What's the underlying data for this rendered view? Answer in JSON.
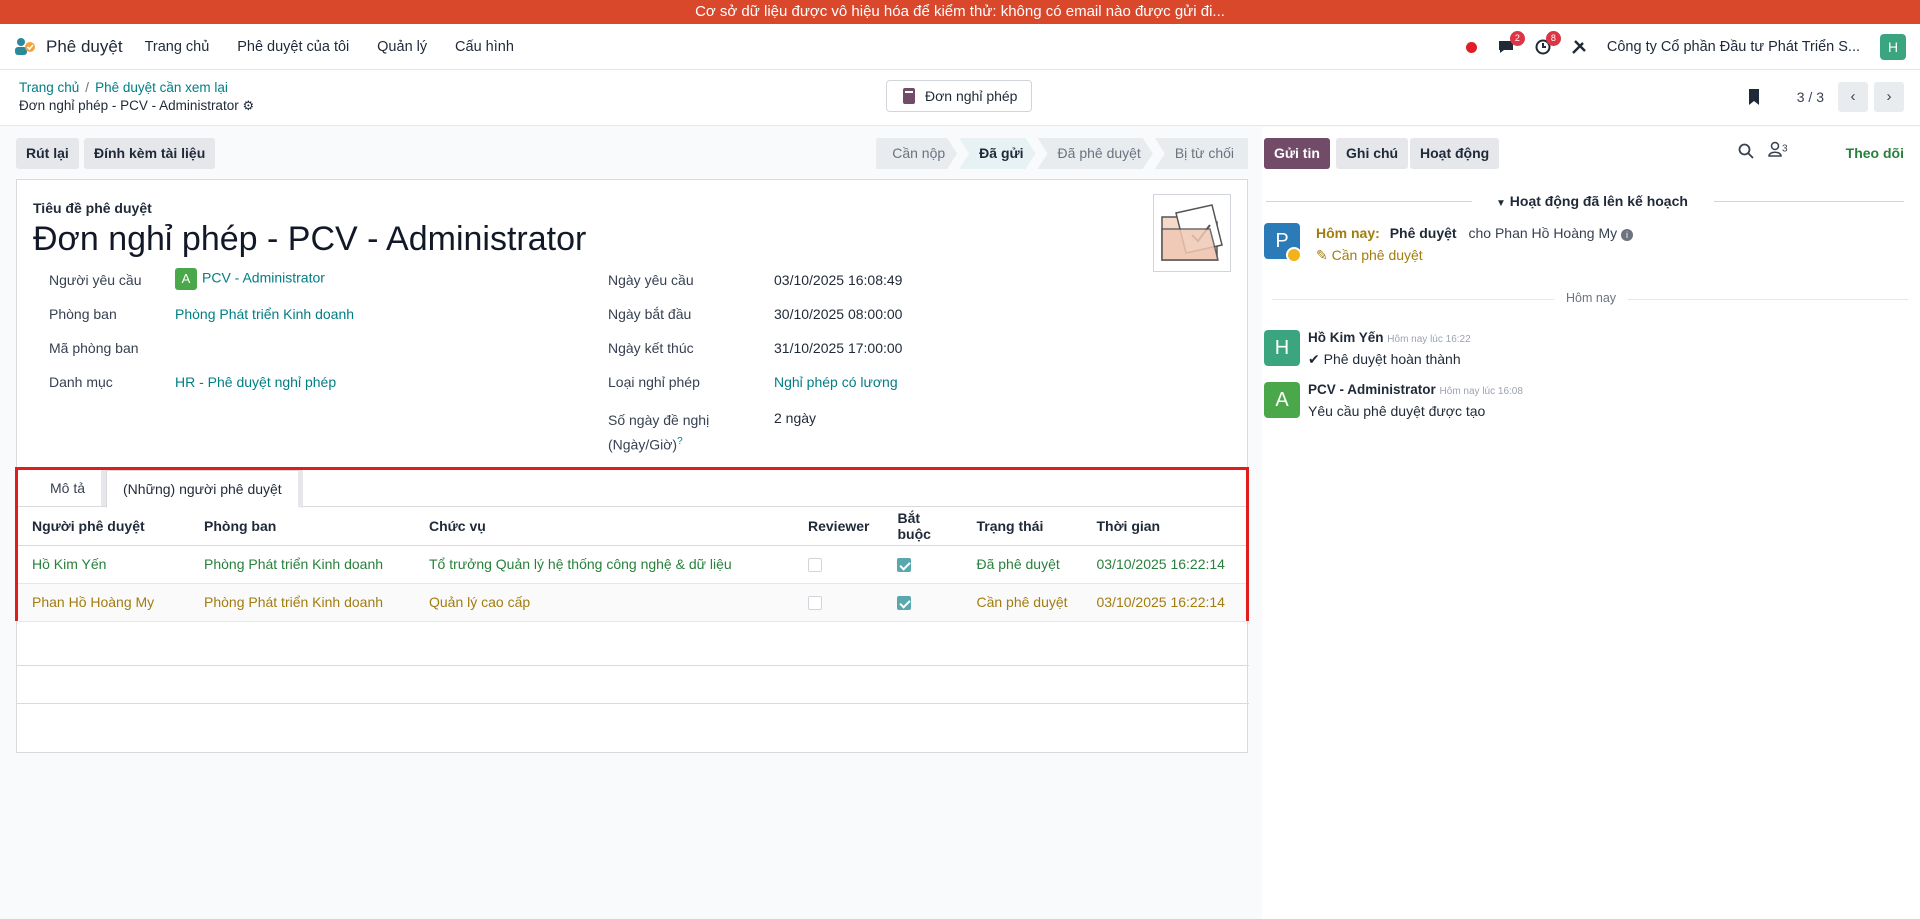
{
  "banner": {
    "text": "Cơ sở dữ liệu được vô hiệu hóa để kiểm thử: không có email nào được gửi đi..."
  },
  "navbar": {
    "app_name": "Phê duyệt",
    "menu": [
      "Trang chủ",
      "Phê duyệt của tôi",
      "Quản lý",
      "Cấu hình"
    ],
    "messages_count": "2",
    "activities_count": "8",
    "company": "Công ty Cổ phần Đầu tư Phát Triển S...",
    "user_initial": "H"
  },
  "breadcrumb": {
    "home": "Trang chủ",
    "parent": "Phê duyệt cần xem lại",
    "current": "Đơn nghỉ phép - PCV - Administrator"
  },
  "center_button": "Đơn nghỉ phép",
  "pager": {
    "text": "3 / 3"
  },
  "actions": {
    "withdraw": "Rút lại",
    "attach": "Đính kèm tài liệu"
  },
  "stages": [
    "Cần nộp",
    "Đã gửi",
    "Đã phê duyệt",
    "Bị từ chối"
  ],
  "active_stage": "Đã gửi",
  "form": {
    "title_label": "Tiêu đề phê duyệt",
    "title": "Đơn nghỉ phép - PCV - Administrator",
    "requester_label": "Người yêu cầu",
    "requester_initial": "A",
    "requester": "PCV - Administrator",
    "department_label": "Phòng ban",
    "department": "Phòng Phát triển Kinh doanh",
    "dept_code_label": "Mã phòng ban",
    "category_label": "Danh mục",
    "category": "HR - Phê duyệt nghỉ phép",
    "request_date_label": "Ngày yêu cầu",
    "request_date": "03/10/2025 16:08:49",
    "start_date_label": "Ngày bắt đầu",
    "start_date": "30/10/2025 08:00:00",
    "end_date_label": "Ngày kết thúc",
    "end_date": "31/10/2025 17:00:00",
    "leave_type_label": "Loại nghỉ phép",
    "leave_type": "Nghỉ phép có lương",
    "days_label_1": "Số ngày đề nghị",
    "days_label_2": "(Ngày/Giờ)",
    "days_help": "?",
    "days": "2 ngày"
  },
  "tabs": [
    "Mô tả",
    "(Những) người phê duyệt"
  ],
  "approvers": {
    "columns": [
      "Người phê duyệt",
      "Phòng ban",
      "Chức vụ",
      "Reviewer",
      "Bắt buộc",
      "Trạng thái",
      "Thời gian"
    ],
    "rows": [
      {
        "name": "Hồ Kim Yến",
        "department": "Phòng Phát triển Kinh doanh",
        "position": "Tổ trưởng Quản lý hệ thống công nghệ & dữ liệu",
        "reviewer": false,
        "required": true,
        "status": "Đã phê duyệt",
        "time": "03/10/2025 16:22:14"
      },
      {
        "name": "Phan Hồ Hoàng My",
        "department": "Phòng Phát triển Kinh doanh",
        "position": "Quản lý cao cấp",
        "reviewer": false,
        "required": true,
        "status": "Cần phê duyệt",
        "time": "03/10/2025 16:22:14"
      }
    ]
  },
  "chatter": {
    "send": "Gửi tin",
    "note": "Ghi chú",
    "activity": "Hoạt động",
    "followers_count": "3",
    "follow": "Theo dõi",
    "planned_title": "Hoạt động đã lên kế hoạch",
    "planned": {
      "initial": "P",
      "when": "Hôm nay:",
      "what": "Phê duyệt",
      "for": "cho Phan Hồ Hoàng My",
      "summary": "Cần phê duyệt"
    },
    "today": "Hôm nay",
    "messages": [
      {
        "initial": "H",
        "author": "Hồ Kim Yến",
        "time": "Hôm nay lúc 16:22",
        "body": "Phê duyệt hoàn thành"
      },
      {
        "initial": "A",
        "author": "PCV - Administrator",
        "time": "Hôm nay lúc 16:08",
        "body": "Yêu cầu phê duyệt được tạo"
      }
    ]
  },
  "colors": {
    "brand": "#714b67",
    "teal": "#017e84",
    "banner": "#d9482b",
    "green": "#28803c",
    "amber": "#a27c0f",
    "highlight": "#e21b1b"
  }
}
